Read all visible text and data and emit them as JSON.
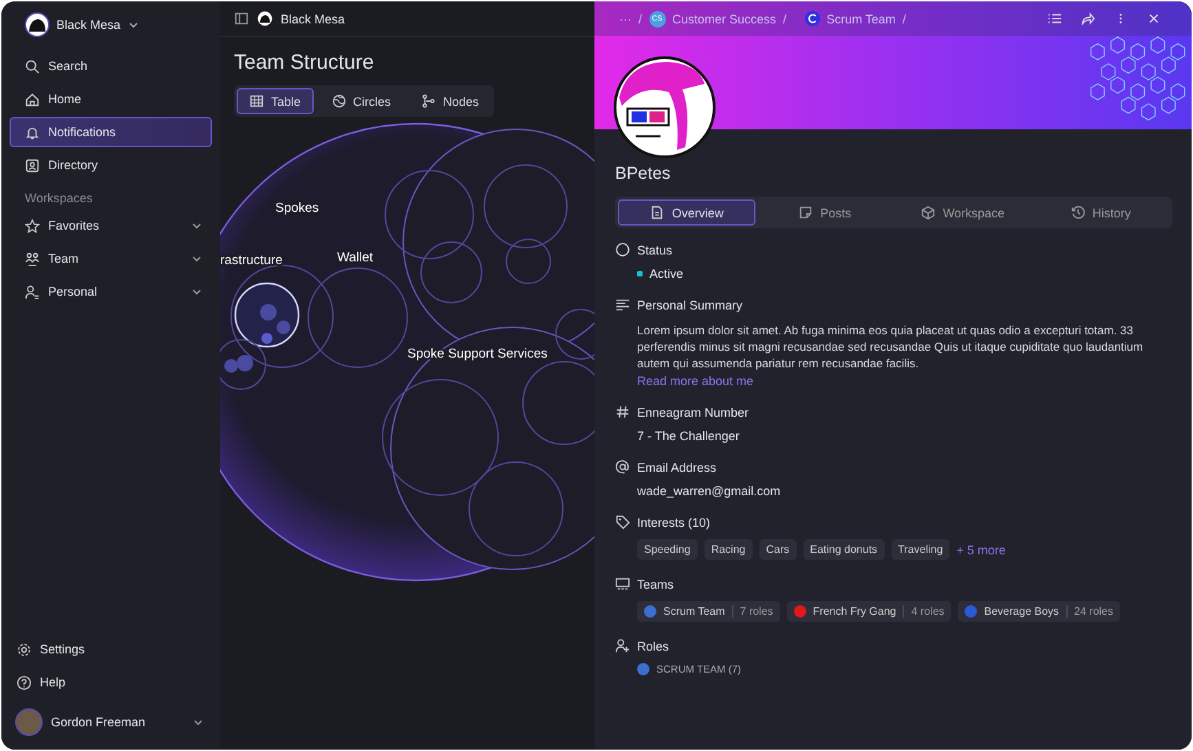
{
  "workspace": {
    "name": "Black Mesa"
  },
  "sidebar": {
    "nav": [
      {
        "label": "Search",
        "selected": false
      },
      {
        "label": "Home",
        "selected": false
      },
      {
        "label": "Notifications",
        "selected": true
      },
      {
        "label": "Directory",
        "selected": false
      }
    ],
    "section_title": "Workspaces",
    "workspaces": [
      {
        "label": "Favorites"
      },
      {
        "label": "Team"
      },
      {
        "label": "Personal"
      }
    ],
    "footer": [
      {
        "label": "Settings"
      },
      {
        "label": "Help"
      }
    ],
    "user": {
      "name": "Gordon Freeman"
    }
  },
  "structure": {
    "breadcrumb": "Black Mesa",
    "title": "Team Structure",
    "views": [
      {
        "label": "Table",
        "selected": true
      },
      {
        "label": "Circles",
        "selected": false
      },
      {
        "label": "Nodes",
        "selected": false
      }
    ],
    "circle_labels": [
      "Spokes",
      "rastructure",
      "Wallet",
      "Spoke Support Services"
    ]
  },
  "profile": {
    "separator": "/",
    "breadcrumbs": [
      {
        "label": "···"
      },
      {
        "badge": "CS",
        "label": "Customer Success"
      },
      {
        "label": "Scrum Team"
      }
    ],
    "name": "BPetes",
    "tabs": [
      {
        "label": "Overview",
        "selected": true
      },
      {
        "label": "Posts",
        "selected": false
      },
      {
        "label": "Workspace",
        "selected": false
      },
      {
        "label": "History",
        "selected": false
      }
    ],
    "fields": [
      {
        "kind": "status",
        "label": "Status",
        "value": "Active"
      },
      {
        "kind": "paragraph",
        "label": "Personal Summary",
        "text": "Lorem ipsum dolor sit amet. Ab fuga minima eos quia placeat ut quas odio a excepturi totam. 33 perferendis minus sit magni recusandae sed recusandae Quis ut itaque cupiditate quo laudantium autem qui assumenda pariatur rem recusandae facilis.",
        "link": "Read more about me"
      },
      {
        "kind": "text",
        "label": "Enneagram Number",
        "value": "7 - The Challenger"
      },
      {
        "kind": "text",
        "label": "Email Address",
        "value": "wade_warren@gmail.com"
      },
      {
        "kind": "tags",
        "label": "Interests (10)",
        "tags": [
          "Speeding",
          "Racing",
          "Cars",
          "Eating donuts",
          "Traveling"
        ],
        "more": "+ 5 more"
      },
      {
        "kind": "teams",
        "label": "Teams",
        "teams": [
          {
            "name": "Scrum Team",
            "roles": "7 roles",
            "color": "#3b6fd0"
          },
          {
            "name": "French Fry Gang",
            "roles": "4 roles",
            "color": "#e01818"
          },
          {
            "name": "Beverage Boys",
            "roles": "24 roles",
            "color": "#2a5bd6"
          }
        ]
      },
      {
        "kind": "roles",
        "label": "Roles",
        "roles": [
          "SCRUM TEAM (7)"
        ]
      }
    ]
  }
}
